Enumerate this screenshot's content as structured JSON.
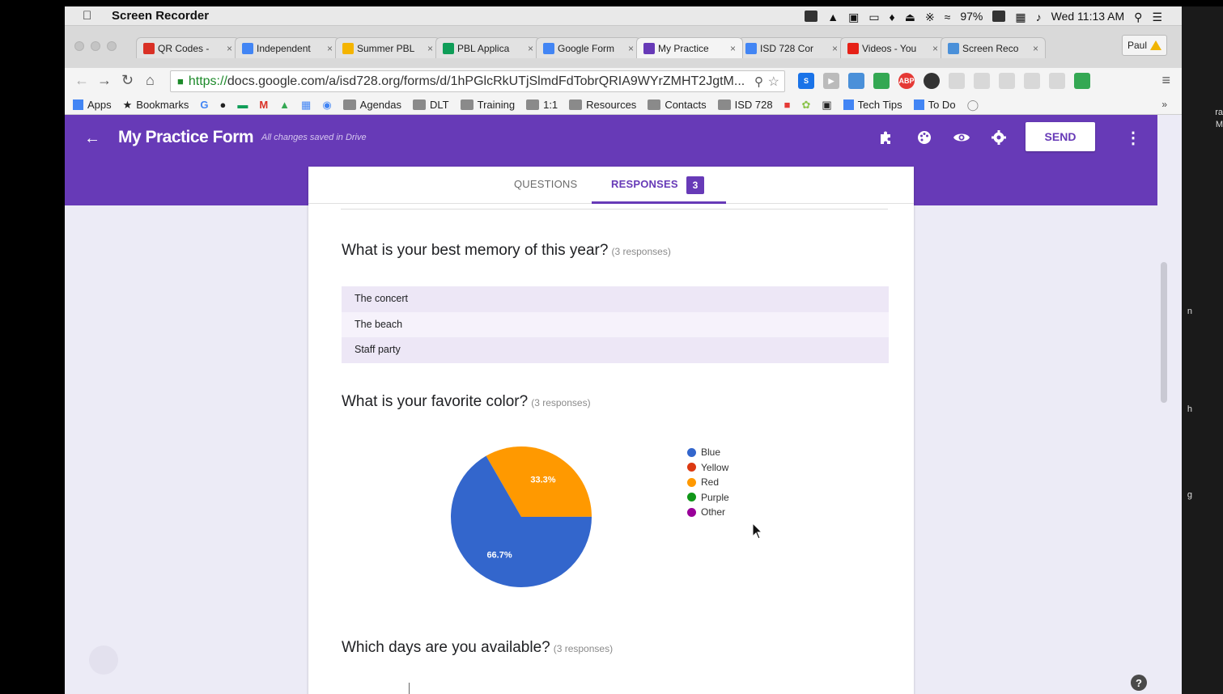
{
  "menubar": {
    "app_name": "Screen Recorder",
    "battery": "97%",
    "clock": "Wed 11:13 AM"
  },
  "tabs": [
    {
      "label": "QR Codes - ",
      "favicon": "gmail-icon",
      "color": "#d93025"
    },
    {
      "label": "Independent",
      "favicon": "calendar-icon",
      "color": "#4285f4"
    },
    {
      "label": "Summer PBL",
      "favicon": "slides-icon",
      "color": "#f4b400"
    },
    {
      "label": "PBL Applica",
      "favicon": "sheets-icon",
      "color": "#0f9d58"
    },
    {
      "label": "Google Form",
      "favicon": "drive-icon",
      "color": "#4285f4"
    },
    {
      "label": "My Practice",
      "favicon": "forms-icon",
      "color": "#673ab7"
    },
    {
      "label": "ISD 728 Cor",
      "favicon": "docs-icon",
      "color": "#4285f4"
    },
    {
      "label": "Videos - You",
      "favicon": "youtube-icon",
      "color": "#e62117"
    },
    {
      "label": "Screen Reco",
      "favicon": "screen-recorder-icon",
      "color": "#4a90d9"
    }
  ],
  "profile": {
    "name": "Paul"
  },
  "address_bar": {
    "scheme": "https://",
    "rest": "docs.google.com/a/isd728.org/forms/d/1hPGlcRkUTjSlmdFdTobrQRIA9WYrZMHT2JgtM..."
  },
  "bookmarks": {
    "apps": "Apps",
    "bookmarks": "Bookmarks",
    "agendas": "Agendas",
    "dlt": "DLT",
    "training": "Training",
    "one_to_one": "1:1",
    "resources": "Resources",
    "contacts": "Contacts",
    "isd728": "ISD 728",
    "tech_tips": "Tech Tips",
    "to_do": "To Do",
    "more": "»"
  },
  "form_header": {
    "title": "My Practice Form",
    "saved_status": "All changes saved in Drive",
    "send_label": "SEND"
  },
  "form_tabs": {
    "questions": "QUESTIONS",
    "responses": "RESPONSES",
    "responses_count": "3"
  },
  "questions": {
    "memory": {
      "title": "What is your best memory of this year?",
      "count": "(3 responses)",
      "answers": [
        "The concert",
        "The beach",
        "Staff party"
      ]
    },
    "color": {
      "title": "What is your favorite color?",
      "count": "(3 responses)"
    },
    "days": {
      "title": "Which days are you available?",
      "count": "(3 responses)"
    }
  },
  "chart_data": {
    "type": "pie",
    "slices": [
      {
        "label": "Blue",
        "value": 66.7,
        "display": "66.7%",
        "color": "#3366cc"
      },
      {
        "label": "Red",
        "value": 33.3,
        "display": "33.3%",
        "color": "#ff9900"
      }
    ],
    "legend": [
      {
        "label": "Blue",
        "color": "#3366cc"
      },
      {
        "label": "Yellow",
        "color": "#dc3912"
      },
      {
        "label": "Red",
        "color": "#ff9900"
      },
      {
        "label": "Purple",
        "color": "#109618"
      },
      {
        "label": "Other",
        "color": "#990099"
      }
    ],
    "legend_position": "right"
  },
  "right_strip": {
    "t1": "ra",
    "t2": "M",
    "t3": "n",
    "t4": "h",
    "t5": "g"
  },
  "help": "?"
}
